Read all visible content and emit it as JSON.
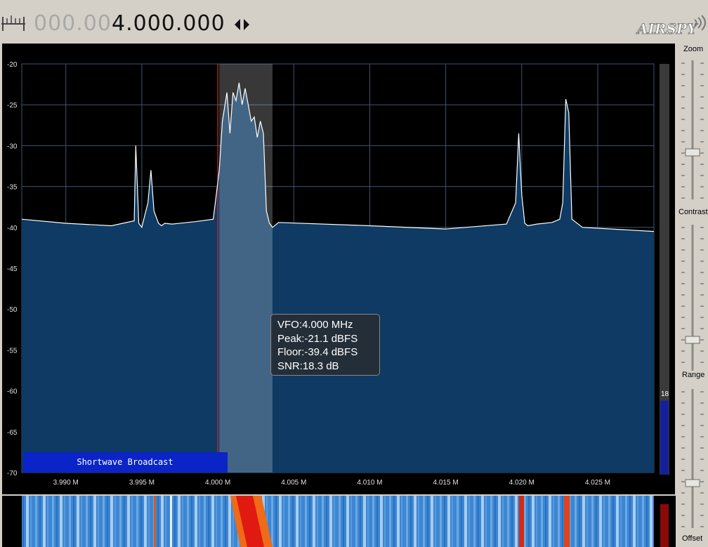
{
  "frequency": {
    "dim_digits": "000.00",
    "lit_digits": "4.000.000"
  },
  "logo": {
    "text": "AIRSPY"
  },
  "chart_data": {
    "type": "line",
    "title": "",
    "xlabel": "",
    "ylabel": "",
    "x_unit": "MHz",
    "xlim": [
      3.9871,
      4.0287
    ],
    "ylim": [
      -70,
      -20
    ],
    "x_ticks": [
      3.99,
      3.995,
      4.0,
      4.005,
      4.01,
      4.015,
      4.02,
      4.025
    ],
    "x_tick_labels": [
      "3.990 M",
      "3.995 M",
      "4.000 M",
      "4.005 M",
      "4.010 M",
      "4.015 M",
      "4.020 M",
      "4.025 M"
    ],
    "y_ticks": [
      -20,
      -25,
      -30,
      -35,
      -40,
      -45,
      -50,
      -55,
      -60,
      -65,
      -70
    ],
    "y_tick_labels": [
      "-20",
      "-25",
      "-30",
      "-35",
      "-40",
      "-45",
      "-50",
      "-55",
      "-60",
      "-65",
      "-70"
    ],
    "grid": true,
    "noise_floor_dbfs": -39.4,
    "vfo_marker_mhz": 4.0,
    "filter_band_mhz": [
      4.0001,
      4.0036
    ],
    "series": [
      {
        "x": [
          3.9871,
          3.99,
          3.993,
          3.9945,
          3.9946,
          3.9948,
          3.995,
          3.9952,
          3.9954,
          3.9956,
          3.9958,
          3.9961,
          3.9963,
          3.9965,
          3.997,
          3.9985,
          3.9997,
          4.0001,
          4.0003,
          4.0006,
          4.0008,
          4.001,
          4.0012,
          4.0014,
          4.0016,
          4.0018,
          4.002,
          4.0022,
          4.0024,
          4.0026,
          4.0028,
          4.003,
          4.0032,
          4.0034,
          4.0036,
          4.004,
          4.01,
          4.015,
          4.019,
          4.0196,
          4.0198,
          4.02,
          4.0202,
          4.0204,
          4.021,
          4.022,
          4.0225,
          4.0227,
          4.0229,
          4.0231,
          4.0233,
          4.024,
          4.0287
        ],
        "y": [
          -39.0,
          -39.5,
          -39.8,
          -39.2,
          -30.0,
          -39.5,
          -40.0,
          -38.5,
          -37.0,
          -33.0,
          -38.0,
          -39.5,
          -39.8,
          -39.5,
          -39.6,
          -39.3,
          -39.0,
          -33.0,
          -27.0,
          -23.5,
          -28.5,
          -23.5,
          -24.5,
          -22.3,
          -25.0,
          -23.0,
          -25.0,
          -27.0,
          -26.5,
          -29.0,
          -27.0,
          -28.5,
          -38.0,
          -39.5,
          -40.0,
          -39.4,
          -39.8,
          -40.2,
          -39.6,
          -37.0,
          -28.5,
          -36.0,
          -39.5,
          -39.8,
          -39.6,
          -39.4,
          -39.0,
          -37.0,
          -24.3,
          -26.0,
          -39.0,
          -40.0,
          -40.5
        ]
      }
    ],
    "annotations": [
      "Shortwave Broadcast"
    ]
  },
  "tooltip": {
    "line1": "VFO:4.000 MHz",
    "line2": "Peak:-21.1 dBFS",
    "line3": "Floor:-39.4 dBFS",
    "line4": "SNR:18.3 dB"
  },
  "level_meter": {
    "value_label": "18",
    "fraction": 0.18
  },
  "side": {
    "zoom": "Zoom",
    "contrast": "Contrast",
    "range": "Range",
    "offset": "Offset"
  },
  "colors": {
    "spectrum_fill": "#0e3a63",
    "trace": "#ffffff",
    "grid": "#3c5570",
    "band_label_bg": "#0a24c8",
    "vfo_line": "#cc2a2a",
    "filter_band": "#3d3d3d",
    "background": "#000000",
    "panel": "#d4d0c8"
  },
  "icons": [
    "tuning-ruler-icon",
    "step-left-icon",
    "step-right-icon"
  ]
}
